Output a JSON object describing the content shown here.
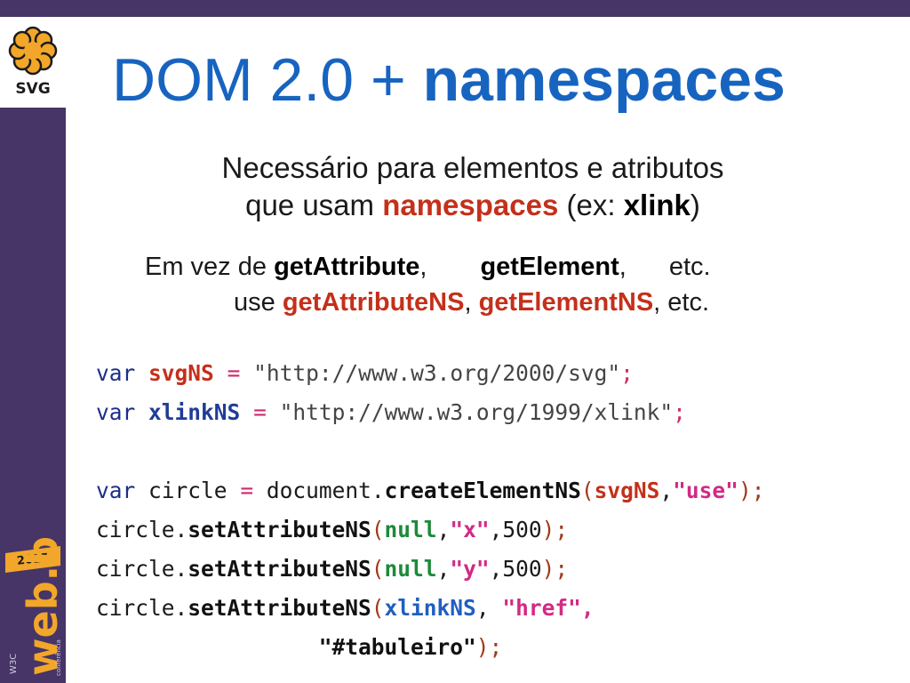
{
  "slide": {
    "logo_label": "SVG",
    "title_plain": "DOM 2.0 + ",
    "title_bold": "namespaces",
    "sub_line1": "Necessário para elementos e atributos",
    "sub_line2_a": "que usam ",
    "sub_line2_red": "namespaces",
    "sub_line2_b": " (ex: ",
    "sub_line2_bold": "xlink",
    "sub_line2_c": ")",
    "line3_a": "Em vez de ",
    "line3_b1": "getAttribute",
    "line3_c1": ",",
    "line3_b2": "getElement",
    "line3_c2": ",",
    "line3_etc": "etc.",
    "line4_a": "use ",
    "line4_r1": "getAttributeNS",
    "line4_c1": ", ",
    "line4_r2": "getElementNS",
    "line4_c2": ", etc."
  },
  "badge": {
    "year": "2015",
    "brand": "web.br",
    "w3c": "W3C",
    "tagline": "conferência"
  },
  "colors": {
    "sidebar": "#463566",
    "title_blue": "#1764c0",
    "accent_red": "#c4301a",
    "logo_yellow": "#f2a72a"
  },
  "code": {
    "l1": [
      "var",
      "svgNS",
      "=",
      "\"http://www.w3.org/2000/svg\"",
      ";"
    ],
    "l2": [
      "var",
      "xlinkNS",
      "=",
      "\"http://www.w3.org/1999/xlink\"",
      ";"
    ],
    "l3": [
      "var",
      "circle",
      "=",
      "document.",
      "createElementNS",
      "(",
      "svgNS",
      ",",
      "\"use\"",
      ");"
    ],
    "l4": [
      "circle.",
      "setAttributeNS",
      "(",
      "null",
      ",",
      "\"x\"",
      ",500",
      ");"
    ],
    "l5": [
      "circle.",
      "setAttributeNS",
      "(",
      "null",
      ",",
      "\"y\"",
      ",500",
      ");"
    ],
    "l6": [
      "circle.",
      "setAttributeNS",
      "(",
      "xlinkNS",
      ", ",
      "\"href\"",
      ","
    ],
    "l7": [
      "\"#tabuleiro\"",
      ");"
    ]
  }
}
